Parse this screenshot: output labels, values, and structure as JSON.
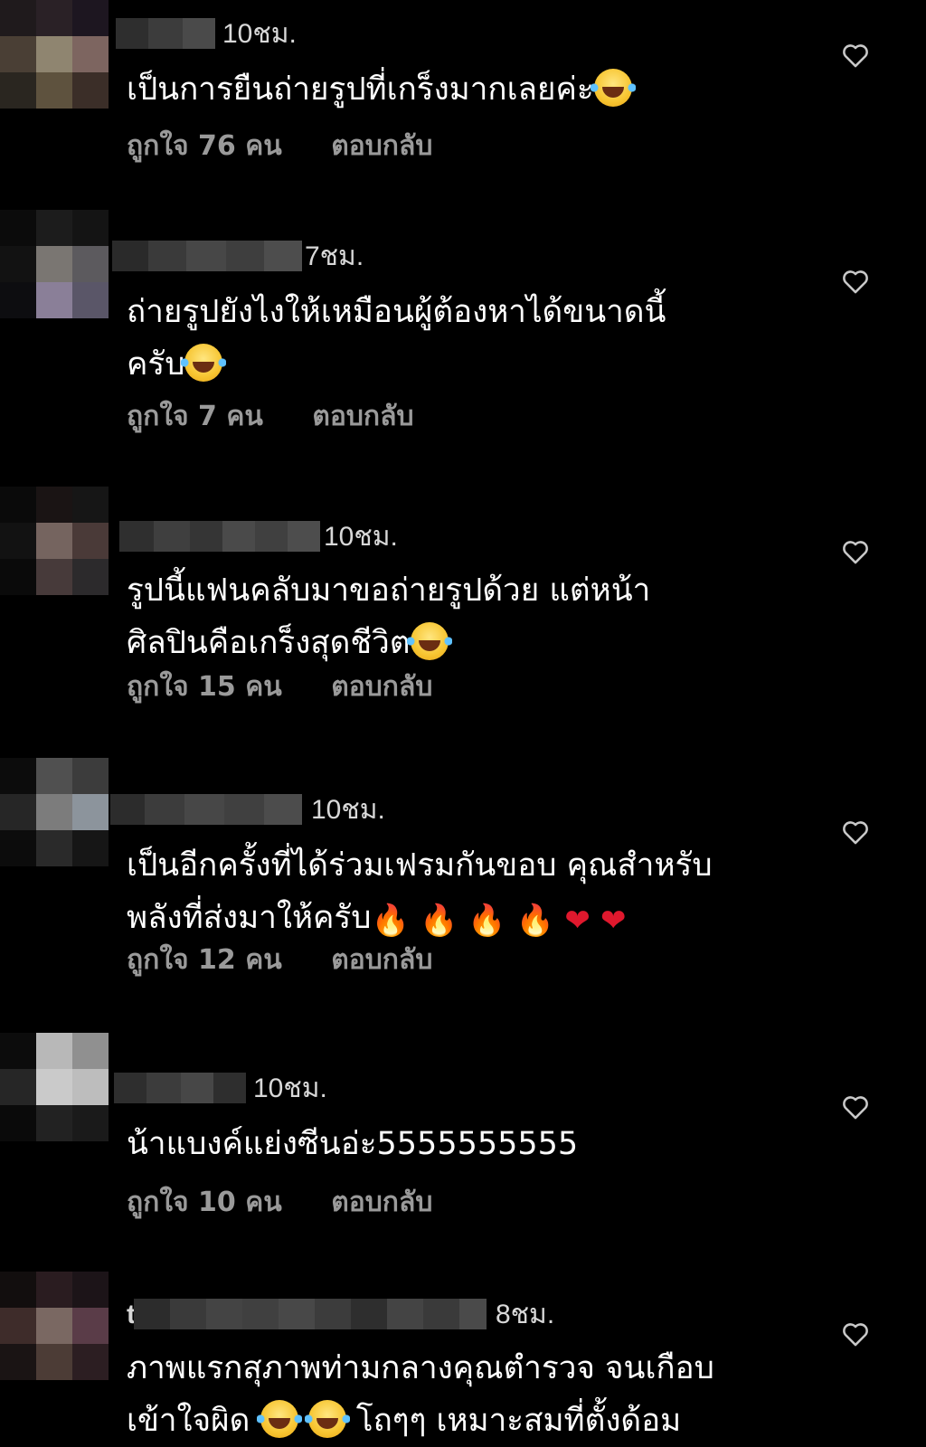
{
  "comments": [
    {
      "time": "10ชม.",
      "text_lines": [
        "เป็นการยืนถ่ายรูปที่เกร็งมากเลยค่ะ"
      ],
      "emoji_after": [
        "laugh"
      ],
      "likes": "ถูกใจ 76 คน",
      "reply": "ตอบกลับ"
    },
    {
      "time": "7ชม.",
      "text_lines": [
        "ถ่ายรูปยังไงให้เหมือนผู้ต้องหาได้ขนาดนี้",
        "ครับ"
      ],
      "emoji_after": [
        "laugh"
      ],
      "likes": "ถูกใจ 7 คน",
      "reply": "ตอบกลับ"
    },
    {
      "time": "10ชม.",
      "text_lines": [
        "รูปนี้แฟนคลับมาขอถ่ายรูปด้วย แต่หน้า",
        "ศิลปินคือเกร็งสุดชีวิต"
      ],
      "emoji_after": [
        "laugh"
      ],
      "likes": "ถูกใจ 15 คน",
      "reply": "ตอบกลับ"
    },
    {
      "time": "10ชม.",
      "text_lines": [
        "เป็นอีกครั้งที่ได้ร่วมเฟรมกันขอบ คุณสำหรับ",
        "พลังที่ส่งมาให้ครับ"
      ],
      "emoji_after": [
        "fire",
        "fire",
        "fire",
        "fire",
        "heart",
        "heart"
      ],
      "likes": "ถูกใจ 12 คน",
      "reply": "ตอบกลับ"
    },
    {
      "time": "10ชม.",
      "text_lines": [
        "น้าแบงค์แย่งซีนอ่ะ5555555555"
      ],
      "emoji_after": [],
      "likes": "ถูกใจ 10 คน",
      "reply": "ตอบกลับ"
    },
    {
      "username_initial": "t",
      "time": "8ชม.",
      "text_lines": [
        "ภาพแรกสุภาพท่ามกลางคุณตำรวจ จนเกือบ",
        "เข้าใจผิด"
      ],
      "line2_tail": "โถๆๆ เหมาะสมที่ตั้งด้อม",
      "emoji_after": [
        "laugh",
        "laugh"
      ]
    }
  ],
  "icons": {
    "heart_outline": "heart-outline-icon",
    "emoji_laugh": "face-with-tears-of-joy",
    "emoji_fire": "fire",
    "emoji_heart": "red-heart"
  }
}
